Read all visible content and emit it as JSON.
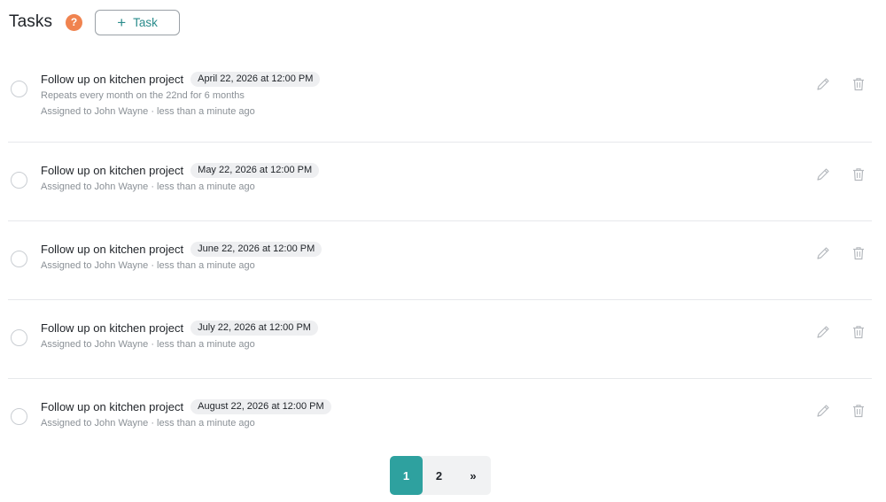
{
  "header": {
    "title": "Tasks",
    "help_glyph": "?",
    "add_task_label": "Task",
    "add_icon_glyph": "+"
  },
  "colors": {
    "accent": "#2ea19f",
    "help_badge": "#f0834f",
    "muted_text": "#8a9096"
  },
  "icons": {
    "help": "help-icon",
    "add": "plus-icon",
    "edit": "pencil-icon",
    "delete": "trash-icon",
    "checkbox": "circle-checkbox"
  },
  "tasks": [
    {
      "name": "Follow up on kitchen project",
      "date": "April 22, 2026 at 12:00 PM",
      "repeat": "Repeats every month on the 22nd for 6 months",
      "assigned": "Assigned to John Wayne · less than a minute ago"
    },
    {
      "name": "Follow up on kitchen project",
      "date": "May 22, 2026 at 12:00 PM",
      "assigned": "Assigned to John Wayne · less than a minute ago"
    },
    {
      "name": "Follow up on kitchen project",
      "date": "June 22, 2026 at 12:00 PM",
      "assigned": "Assigned to John Wayne · less than a minute ago"
    },
    {
      "name": "Follow up on kitchen project",
      "date": "July 22, 2026 at 12:00 PM",
      "assigned": "Assigned to John Wayne · less than a minute ago"
    },
    {
      "name": "Follow up on kitchen project",
      "date": "August 22, 2026 at 12:00 PM",
      "assigned": "Assigned to John Wayne · less than a minute ago"
    }
  ],
  "pagination": {
    "pages": [
      "1",
      "2"
    ],
    "current": "1",
    "next_label": "»"
  }
}
